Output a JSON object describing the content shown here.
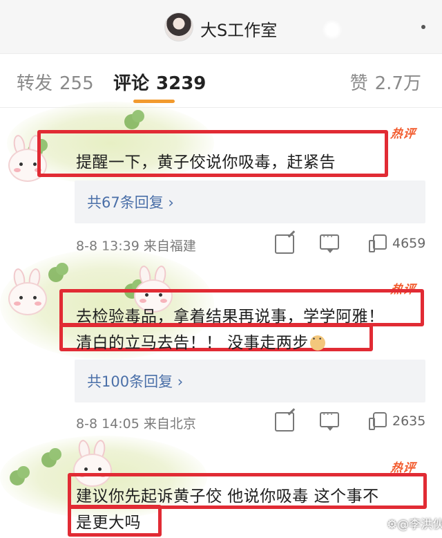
{
  "header": {
    "title": "大S工作室"
  },
  "tabs": {
    "forward": {
      "label": "转发",
      "count": "255"
    },
    "comments": {
      "label": "评论",
      "count": "3239"
    },
    "likes": {
      "label": "赞",
      "count": "2.7万"
    }
  },
  "comments": [
    {
      "hot_badge": "热评",
      "lines": [
        "提醒一下，黄子佼说你吸毒，赶紧告"
      ],
      "replies": "共67条回复 ›",
      "time": "8-8 13:39",
      "location": "来自福建",
      "likes": "4659"
    },
    {
      "hot_badge": "热评",
      "lines": [
        "去检验毒品，拿着结果再说事，学学阿雅！",
        "清白的立马去告！！ 没事走两步"
      ],
      "replies": "共100条回复 ›",
      "time": "8-8 14:05",
      "location": "来自北京",
      "likes": "2635"
    },
    {
      "hot_badge": "热评",
      "lines": [
        "建议你先起诉黄子佼  他说你吸毒  这个事不",
        "是更大吗"
      ]
    }
  ],
  "watermark": "⚙@李洪伙",
  "colors": {
    "accent_underline": "#f29a2e",
    "highlight_box": "#e12b34",
    "hot_badge": "#f25a2c",
    "link": "#4a6fa8"
  },
  "icons": [
    "share-icon",
    "comment-reply-icon",
    "like-thumb-icon"
  ]
}
